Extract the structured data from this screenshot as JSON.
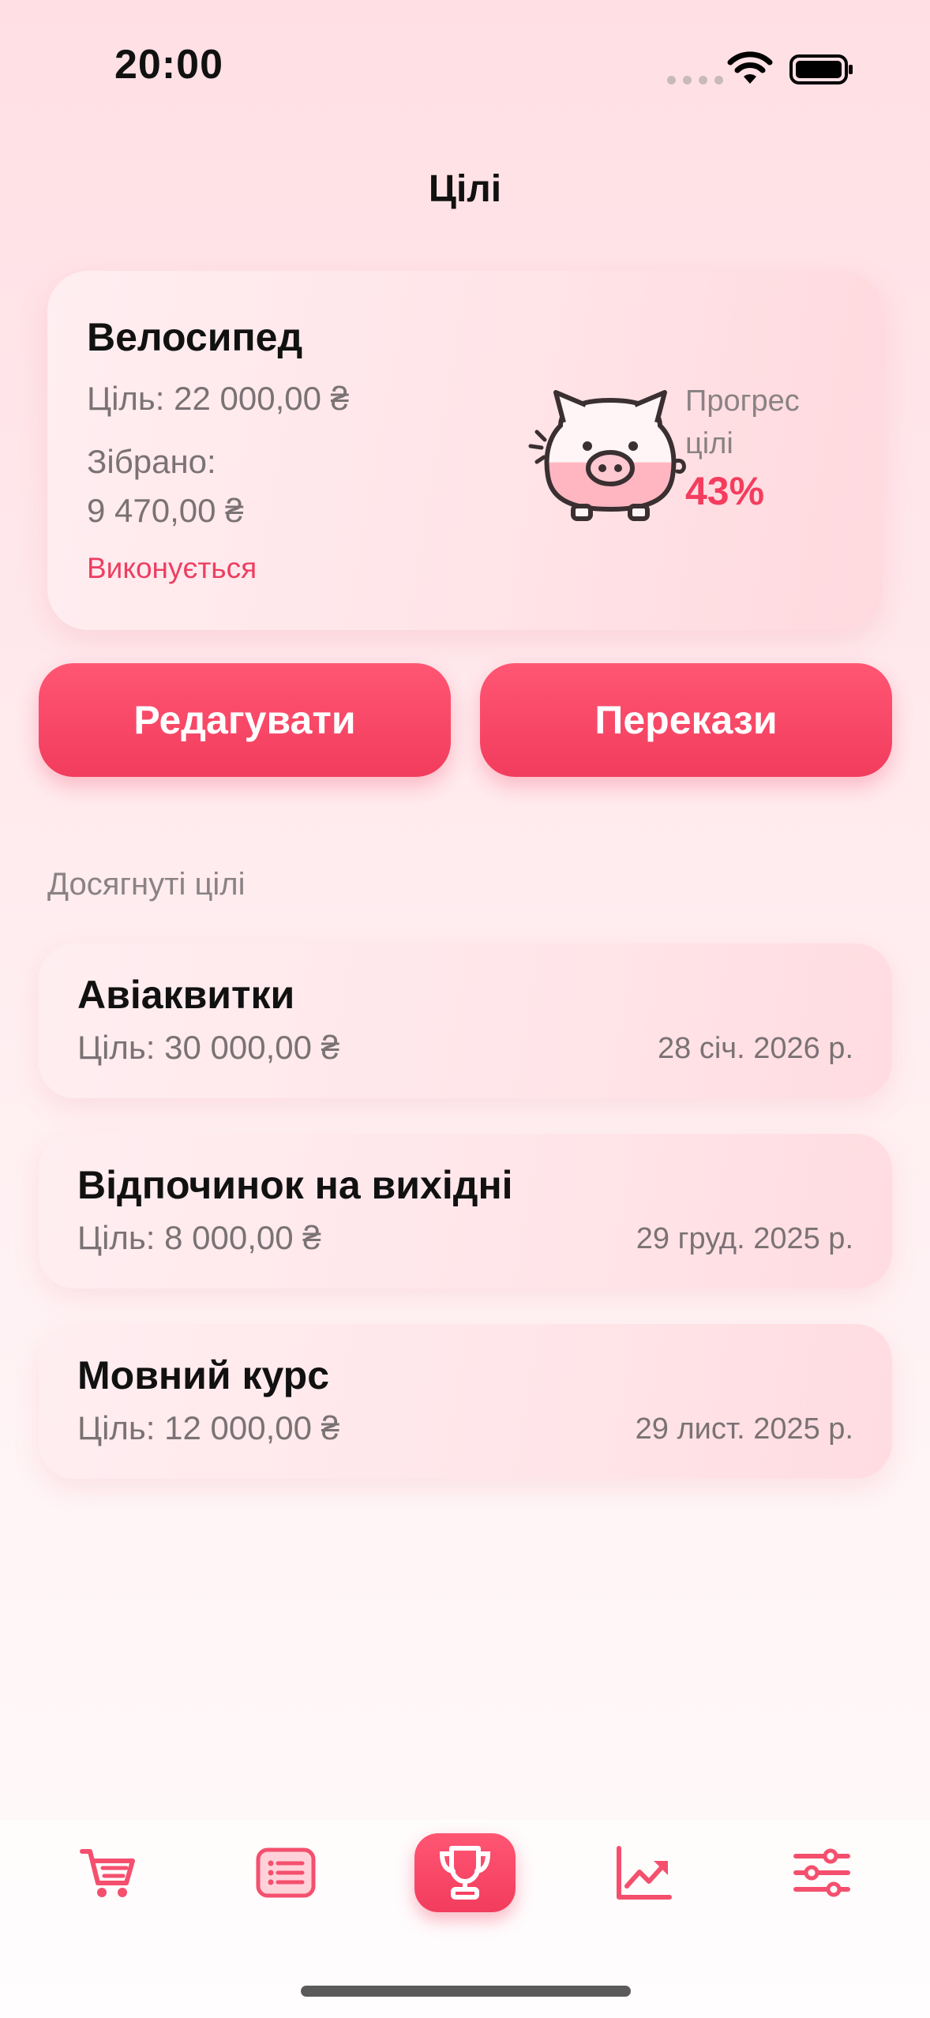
{
  "status_bar": {
    "time": "20:00"
  },
  "page": {
    "title": "Цілі"
  },
  "current_goal": {
    "name": "Велосипед",
    "target": "Ціль: 22 000,00 ₴",
    "collected_label": "Зібрано:",
    "collected_value": "9 470,00 ₴",
    "status": "Виконується",
    "progress_label": "Прогрес цілі",
    "progress_value": "43%",
    "progress_fraction": 0.43
  },
  "actions": {
    "edit_label": "Редагувати",
    "transfers_label": "Перекази"
  },
  "achieved": {
    "section_title": "Досягнуті цілі",
    "items": [
      {
        "name": "Авіаквитки",
        "target": "Ціль: 30 000,00 ₴",
        "date": "28 січ. 2026 р."
      },
      {
        "name": "Відпочинок на вихідні",
        "target": "Ціль: 8 000,00 ₴",
        "date": "29 груд. 2025 р."
      },
      {
        "name": "Мовний курс",
        "target": "Ціль: 12 000,00 ₴",
        "date": "29 лист. 2025 р."
      }
    ]
  },
  "tab_bar": {
    "icons": [
      "cart-icon",
      "list-icon",
      "trophy-icon",
      "chart-icon",
      "sliders-icon"
    ],
    "active": "trophy-icon"
  },
  "colors": {
    "accent": "#F43D5E",
    "pig_fill": "#FFB6C1",
    "outline": "#3A2F31"
  }
}
